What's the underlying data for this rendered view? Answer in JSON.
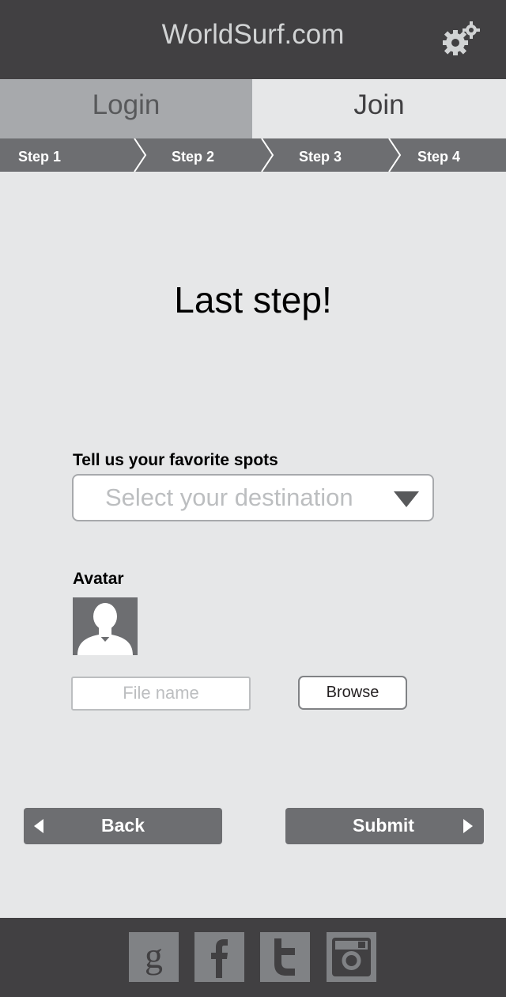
{
  "header": {
    "title": "WorldSurf.com",
    "settings_icon": "gear-icon"
  },
  "tabs": [
    {
      "label": "Login",
      "active": false
    },
    {
      "label": "Join",
      "active": true
    }
  ],
  "steps": [
    {
      "label": "Step 1"
    },
    {
      "label": "Step 2"
    },
    {
      "label": "Step 3"
    },
    {
      "label": "Step 4"
    }
  ],
  "main": {
    "headline": "Last step!",
    "spots": {
      "label": "Tell us your favorite spots",
      "value": "Select your destination"
    },
    "avatar": {
      "label": "Avatar",
      "file_placeholder": "File name",
      "browse_label": "Browse"
    }
  },
  "actions": {
    "back_label": "Back",
    "submit_label": "Submit"
  },
  "footer": {
    "social": [
      {
        "icon": "google-icon"
      },
      {
        "icon": "facebook-icon"
      },
      {
        "icon": "twitter-icon"
      },
      {
        "icon": "instagram-icon"
      }
    ]
  },
  "colors": {
    "header_bg": "#414042",
    "page_bg": "#e6e7e8",
    "step_bar": "#6d6e71",
    "inactive_tab": "#a7a9ac"
  }
}
